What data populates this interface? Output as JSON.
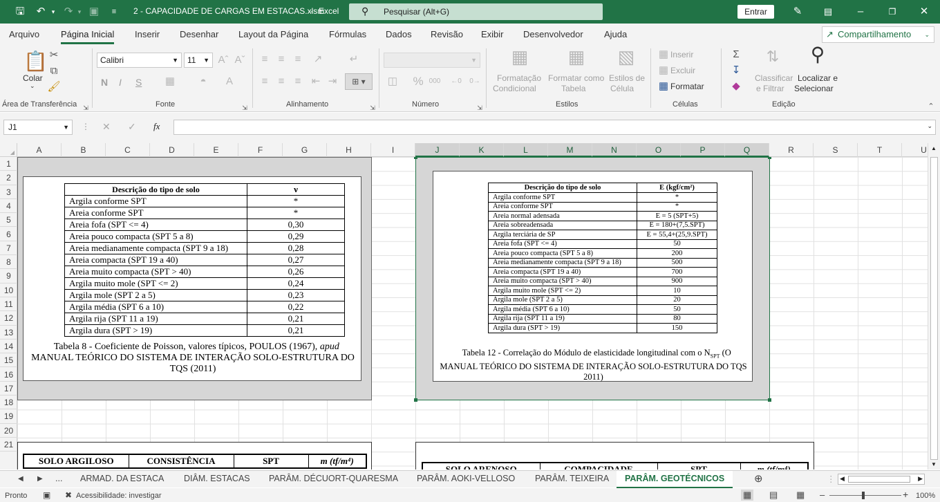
{
  "titlebar": {
    "filename": "2 - CAPACIDADE DE CARGAS EM ESTACAS.xlsm",
    "app": "Excel",
    "title_sep": "-",
    "search_placeholder": "Pesquisar (Alt+G)",
    "signin": "Entrar",
    "icons": [
      "save-icon",
      "undo-icon",
      "redo-icon",
      "touch-mode-icon",
      "customize-icon",
      "pen-icon",
      "ribbon-display-icon",
      "minimize-icon",
      "restore-icon",
      "close-icon"
    ]
  },
  "menu": {
    "tabs": [
      "Arquivo",
      "Página Inicial",
      "Inserir",
      "Desenhar",
      "Layout da Página",
      "Fórmulas",
      "Dados",
      "Revisão",
      "Exibir",
      "Desenvolvedor",
      "Ajuda"
    ],
    "share": "Compartilhamento"
  },
  "ribbon": {
    "clipboard": {
      "paste": "Colar",
      "label": "Área de Transferência"
    },
    "font": {
      "name": "Calibri",
      "size": "11",
      "bold": "N",
      "italic": "I",
      "underline": "S",
      "label": "Fonte"
    },
    "alignment": {
      "label": "Alinhamento"
    },
    "number": {
      "label": "Número"
    },
    "styles": {
      "cond1": "Formatação",
      "cond2": "Condicional",
      "table1": "Formatar como",
      "table2": "Tabela",
      "cell1": "Estilos de",
      "cell2": "Célula",
      "label": "Estilos"
    },
    "cells": {
      "insert": "Inserir",
      "delete": "Excluir",
      "format": "Formatar",
      "label": "Células"
    },
    "editing": {
      "sort1": "Classificar",
      "sort2": "e Filtrar",
      "find1": "Localizar e",
      "find2": "Selecionar",
      "label": "Edição"
    }
  },
  "formula_bar": {
    "name_box": "J1",
    "fx": "fx",
    "value": ""
  },
  "grid": {
    "columns": [
      "A",
      "B",
      "C",
      "D",
      "E",
      "F",
      "G",
      "H",
      "I",
      "J",
      "K",
      "L",
      "M",
      "N",
      "O",
      "P",
      "Q",
      "R",
      "S",
      "T",
      "U"
    ],
    "rows": [
      "1",
      "2",
      "3",
      "4",
      "5",
      "6",
      "7",
      "8",
      "9",
      "10",
      "11",
      "12",
      "13",
      "14",
      "15",
      "16",
      "17",
      "18",
      "19",
      "20",
      "21"
    ]
  },
  "table8": {
    "header": [
      "Descrição do tipo de solo",
      "ν"
    ],
    "rows": [
      [
        "Argila conforme SPT",
        "*"
      ],
      [
        "Areia conforme SPT",
        "*"
      ],
      [
        "Areia fofa (SPT <= 4)",
        "0,30"
      ],
      [
        "Areia pouco compacta (SPT 5 a 8)",
        "0,29"
      ],
      [
        "Areia medianamente compacta (SPT 9 a 18)",
        "0,28"
      ],
      [
        "Areia compacta (SPT 19 a 40)",
        "0,27"
      ],
      [
        "Areia muito compacta (SPT > 40)",
        "0,26"
      ],
      [
        "Argila muito mole (SPT <= 2)",
        "0,24"
      ],
      [
        "Argila mole (SPT 2 a 5)",
        "0,23"
      ],
      [
        "Argila média (SPT 6 a 10)",
        "0,22"
      ],
      [
        "Argila rija (SPT 11 a 19)",
        "0,21"
      ],
      [
        "Argila dura (SPT > 19)",
        "0,21"
      ]
    ],
    "caption_a": "Tabela 8 - Coeficiente de Poisson, valores típicos, POULOS (1967), ",
    "caption_apud": "apud",
    "caption_b": "MANUAL TEÓRICO DO SISTEMA DE INTERAÇÃO SOLO-ESTRUTURA DO TQS (2011)"
  },
  "table12": {
    "header": [
      "Descrição do tipo de solo",
      "E (kgf/cm²)"
    ],
    "rows": [
      [
        "Argila conforme SPT",
        "*"
      ],
      [
        "Areia conforme SPT",
        "*"
      ],
      [
        "Areia normal adensada",
        "E = 5 (SPT+5)"
      ],
      [
        "Areia sobreadensada",
        "E = 180+(7,5.SPT)"
      ],
      [
        "Argila terciária de SP",
        "E = 55,4+(25,9.SPT)"
      ],
      [
        "Areia fofa (SPT <= 4)",
        "50"
      ],
      [
        "Areia pouco compacta (SPT 5 a 8)",
        "200"
      ],
      [
        "Areia medianamente compacta (SPT 9 a 18)",
        "500"
      ],
      [
        "Areia compacta (SPT 19 a 40)",
        "700"
      ],
      [
        "Areia muito compacta (SPT > 40)",
        "900"
      ],
      [
        "Argila muito mole (SPT <= 2)",
        "10"
      ],
      [
        "Argila mole (SPT 2 a 5)",
        "20"
      ],
      [
        "Argila média (SPT 6 a 10)",
        "50"
      ],
      [
        "Argila rija (SPT 11 a 19)",
        "80"
      ],
      [
        "Argila dura (SPT > 19)",
        "150"
      ]
    ],
    "caption_a": "Tabela 12 - Correlação do Módulo de elasticidade longitudinal com o N",
    "caption_sub": "SPT",
    "caption_b": " (O MANUAL TEÓRICO DO SISTEMA DE INTERAÇÃO SOLO-ESTRUTURA DO TQS 2011)"
  },
  "table_argiloso": {
    "header": [
      "SOLO ARGILOSO",
      "CONSISTÊNCIA",
      "SPT",
      "m (tf/m⁴)"
    ]
  },
  "table_arenoso": {
    "header": [
      "SOLO ARENOSO",
      "COMPACIDADE",
      "SPT",
      "m (tf/m⁴)"
    ]
  },
  "sheets": {
    "ellipsis": "...",
    "tabs": [
      "ARMAD. DA ESTACA",
      "DIÂM. ESTACAS",
      "PARÂM. DÉCUORT-QUARESMA",
      "PARÂM. AOKI-VELLOSO",
      "PARÂM. TEIXEIRA",
      "PARÂM. GEOTÉCNICOS"
    ],
    "active": "PARÂM. GEOTÉCNICOS"
  },
  "status": {
    "ready": "Pronto",
    "accessibility": "Acessibilidade: investigar",
    "zoom": "100%"
  }
}
